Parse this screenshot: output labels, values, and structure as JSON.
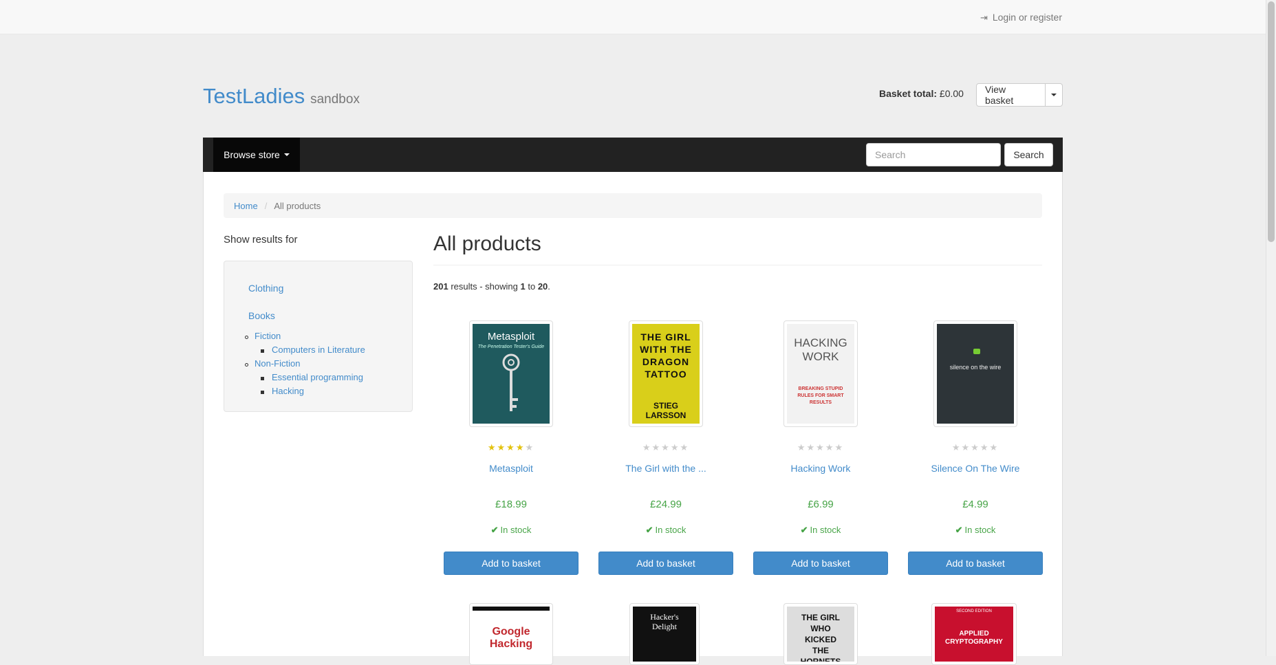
{
  "topbar": {
    "login_label": "Login or register",
    "login_icon": "sign-in-icon"
  },
  "header": {
    "brand_name": "TestLadies",
    "brand_tag": "sandbox",
    "basket_label": "Basket total:",
    "basket_total": "£0.00",
    "view_basket_label": "View basket"
  },
  "navbar": {
    "browse_label": "Browse store",
    "search_placeholder": "Search",
    "search_button_label": "Search",
    "bg_color": "#222222"
  },
  "breadcrumb": {
    "home": "Home",
    "current": "All products"
  },
  "sidebar": {
    "title": "Show results for",
    "categories": [
      {
        "label": "Clothing"
      },
      {
        "label": "Books"
      }
    ],
    "books_children": [
      {
        "label": "Fiction",
        "children": [
          {
            "label": "Computers in Literature"
          }
        ]
      },
      {
        "label": "Non-Fiction",
        "children": [
          {
            "label": "Essential programming"
          },
          {
            "label": "Hacking"
          }
        ]
      }
    ]
  },
  "main": {
    "title": "All products",
    "results_count": "201",
    "results_text_1": "results - showing",
    "showing_from": "1",
    "results_to": "to",
    "showing_to": "20",
    "results_period": "."
  },
  "products": [
    {
      "title": "Metasploit",
      "price": "£18.99",
      "stock": "In stock",
      "button": "Add to basket",
      "rating": 4,
      "cover": {
        "line1": "Metasploit",
        "line2": "The Penetration Tester's Guide"
      }
    },
    {
      "title": "The Girl with the ...",
      "price": "£24.99",
      "stock": "In stock",
      "button": "Add to basket",
      "rating": 0,
      "cover": {
        "line1": "THE GIRL WITH THE DRAGON TATTOO",
        "line2": "STIEG LARSSON"
      }
    },
    {
      "title": "Hacking Work",
      "price": "£6.99",
      "stock": "In stock",
      "button": "Add to basket",
      "rating": 0,
      "cover": {
        "line1": "HACKING WORK",
        "line2": "BREAKING STUPID RULES FOR SMART RESULTS"
      }
    },
    {
      "title": "Silence On The Wire",
      "price": "£4.99",
      "stock": "In stock",
      "button": "Add to basket",
      "rating": 0,
      "cover": {
        "line1": "silence on the wire",
        "line2": ""
      }
    }
  ],
  "products_row2": [
    {
      "cover": {
        "line1": "Google Hacking"
      }
    },
    {
      "cover": {
        "line1": "Hacker's Delight"
      }
    },
    {
      "cover": {
        "line1": "THE GIRL WHO KICKED THE HORNETS"
      }
    },
    {
      "cover": {
        "line1": "APPLIED CRYPTOGRAPHY",
        "line2": "SECOND EDITION"
      }
    }
  ],
  "colors": {
    "link": "#428bca",
    "price_green": "#47a447",
    "button_primary": "#428bca",
    "star_on": "#e3c20f",
    "star_off": "#cccccc"
  }
}
